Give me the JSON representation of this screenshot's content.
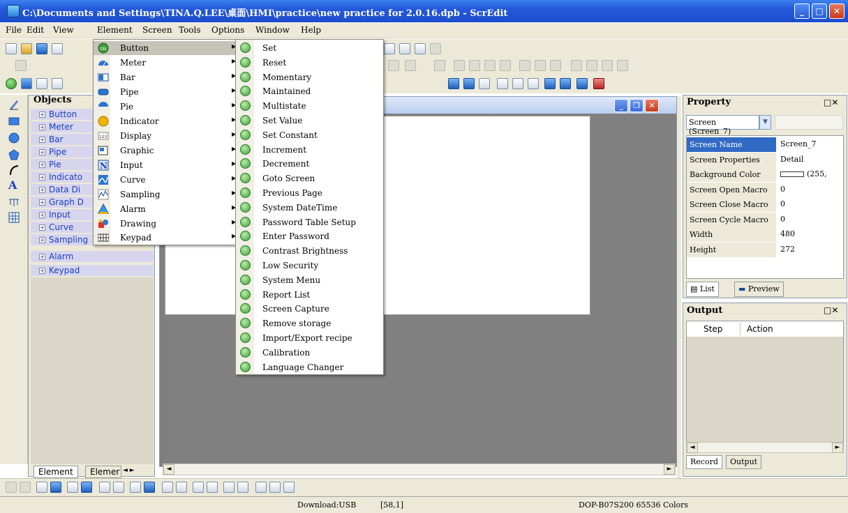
{
  "window": {
    "title": "C:\\Documents and Settings\\TINA.Q.LEE\\桌面\\HMI\\practice\\new practice for 2.0.16.dpb - ScrEdit"
  },
  "menubar": [
    "File",
    "Edit",
    "View",
    "Element",
    "Screen",
    "Tools",
    "Options",
    "Window",
    "Help"
  ],
  "objects": {
    "title": "Objects",
    "items": [
      "Button",
      "Meter",
      "Bar",
      "Pipe",
      "Pie",
      "Indicato",
      "Data Di",
      "Graph D",
      "Input",
      "Curve",
      "Sampling",
      "Alarm",
      "Keypad"
    ],
    "tabs": [
      "Element",
      "Elemer"
    ]
  },
  "element_menu": {
    "items": [
      {
        "label": "Button",
        "icon": "on-button-icon"
      },
      {
        "label": "Meter",
        "icon": "meter-icon"
      },
      {
        "label": "Bar",
        "icon": "bar-icon"
      },
      {
        "label": "Pipe",
        "icon": "pipe-icon"
      },
      {
        "label": "Pie",
        "icon": "pie-icon"
      },
      {
        "label": "Indicator",
        "icon": "indicator-icon"
      },
      {
        "label": "Display",
        "icon": "display-icon"
      },
      {
        "label": "Graphic",
        "icon": "graphic-icon"
      },
      {
        "label": "Input",
        "icon": "input-icon"
      },
      {
        "label": "Curve",
        "icon": "curve-icon"
      },
      {
        "label": "Sampling",
        "icon": "sampling-icon"
      },
      {
        "label": "Alarm",
        "icon": "alarm-icon"
      },
      {
        "label": "Drawing",
        "icon": "drawing-icon"
      },
      {
        "label": "Keypad",
        "icon": "keypad-icon"
      }
    ],
    "highlighted": "Button"
  },
  "button_submenu": {
    "items": [
      "Set",
      "Reset",
      "Momentary",
      "Maintained",
      "Multistate",
      "Set Value",
      "Set Constant",
      "Increment",
      "Decrement",
      "Goto Screen",
      "Previous Page",
      "System DateTime",
      "Password Table Setup",
      "Enter Password",
      "Contrast Brightness",
      "Low Security",
      "System Menu",
      "Report List",
      "Screen Capture",
      "Remove storage",
      "Import/Export recipe",
      "Calibration",
      "Language Changer"
    ]
  },
  "property": {
    "title": "Property",
    "selector": "Screen (Screen_7)",
    "rows": [
      {
        "name": "Screen Name",
        "value": "Screen_7",
        "selected": true
      },
      {
        "name": "Screen Properties",
        "value": "Detail"
      },
      {
        "name": "Background Color",
        "value": "(255,"
      },
      {
        "name": "Screen Open Macro",
        "value": "0"
      },
      {
        "name": "Screen Close Macro",
        "value": "0"
      },
      {
        "name": "Screen Cycle Macro",
        "value": "0"
      },
      {
        "name": "Width",
        "value": "480"
      },
      {
        "name": "Height",
        "value": "272"
      }
    ],
    "tabs": [
      "List",
      "Preview"
    ]
  },
  "output": {
    "title": "Output",
    "columns": [
      "Step",
      "Action"
    ],
    "tabs": [
      "Record",
      "Output"
    ]
  },
  "status": {
    "download": "Download:USB",
    "coords": "[58,1]",
    "device": "DOP-B07S200 65536 Colors"
  },
  "colors": {
    "titlebar": "#2459d9",
    "selection": "#316ac5",
    "menu_highlight": "#c6c3b8"
  }
}
